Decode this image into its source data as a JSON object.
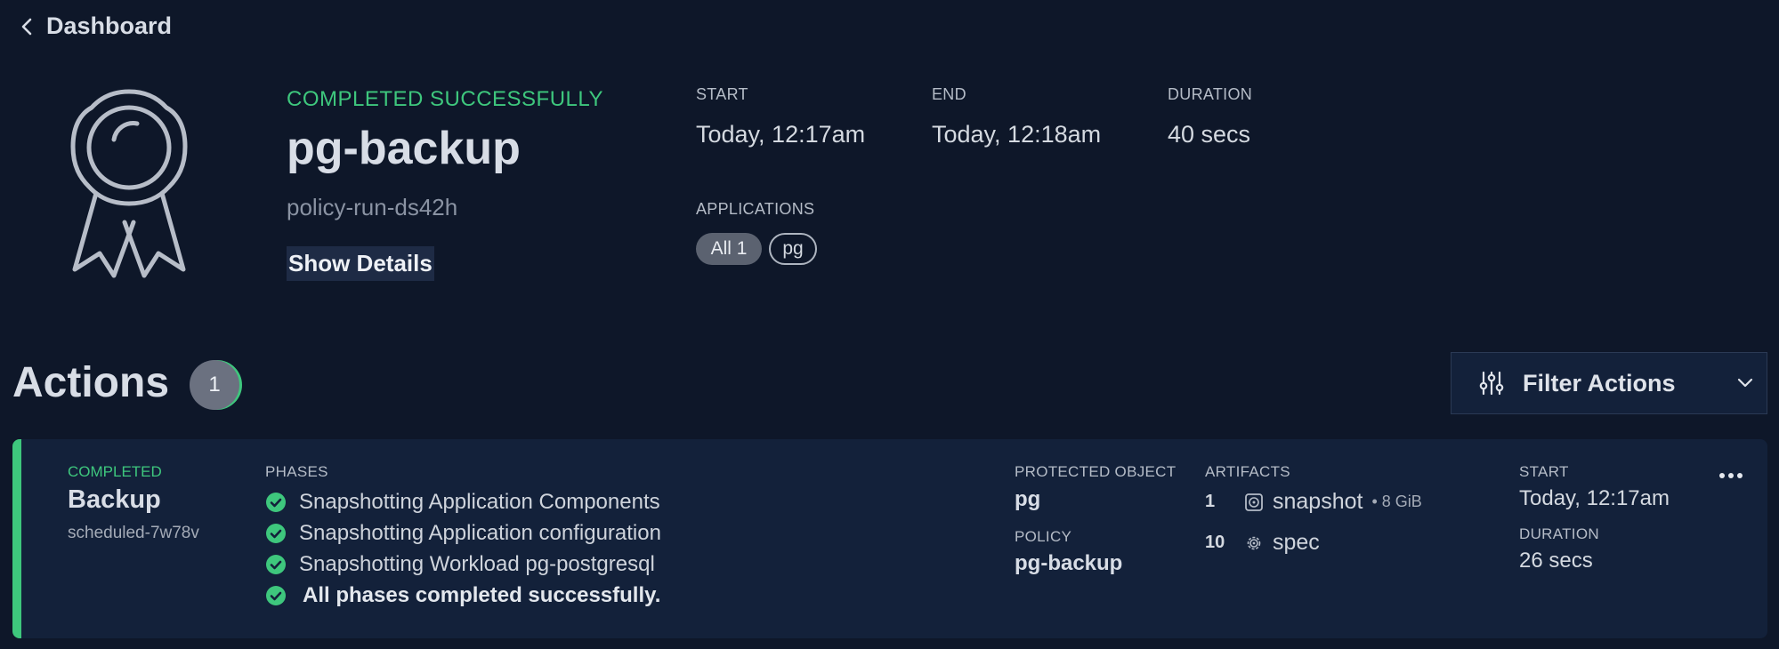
{
  "nav": {
    "back_label": "Dashboard"
  },
  "run": {
    "status": "COMPLETED SUCCESSFULLY",
    "name": "pg-backup",
    "id": "policy-run-ds42h",
    "show_details_label": "Show Details",
    "start_label": "START",
    "start_value": "Today, 12:17am",
    "end_label": "END",
    "end_value": "Today, 12:18am",
    "duration_label": "DURATION",
    "duration_value": "40 secs",
    "applications_label": "APPLICATIONS",
    "applications": [
      {
        "label": "All 1",
        "selected": true
      },
      {
        "label": "pg",
        "selected": false
      }
    ]
  },
  "actions": {
    "title": "Actions",
    "count": "1",
    "filter_label": "Filter Actions",
    "items": [
      {
        "status": "COMPLETED",
        "name": "Backup",
        "id": "scheduled-7w78v",
        "phases_label": "PHASES",
        "phases": [
          "Snapshotting Application Components",
          "Snapshotting Application configuration",
          "Snapshotting Workload pg-postgresql",
          "All phases completed successfully."
        ],
        "protected_object_label": "PROTECTED OBJECT",
        "protected_object": "pg",
        "policy_label": "POLICY",
        "policy": "pg-backup",
        "artifacts_label": "ARTIFACTS",
        "artifacts": [
          {
            "count": "1",
            "icon": "disk-icon",
            "name": "snapshot",
            "size": "• 8 GiB"
          },
          {
            "count": "10",
            "icon": "gear-icon",
            "name": "spec",
            "size": ""
          }
        ],
        "start_label": "START",
        "start_value": "Today, 12:17am",
        "duration_label": "DURATION",
        "duration_value": "26 secs"
      }
    ]
  },
  "colors": {
    "background": "#0e1729",
    "card": "#13213a",
    "success": "#3ec77d",
    "text": "#d8dde6",
    "muted": "#8a93a3"
  }
}
